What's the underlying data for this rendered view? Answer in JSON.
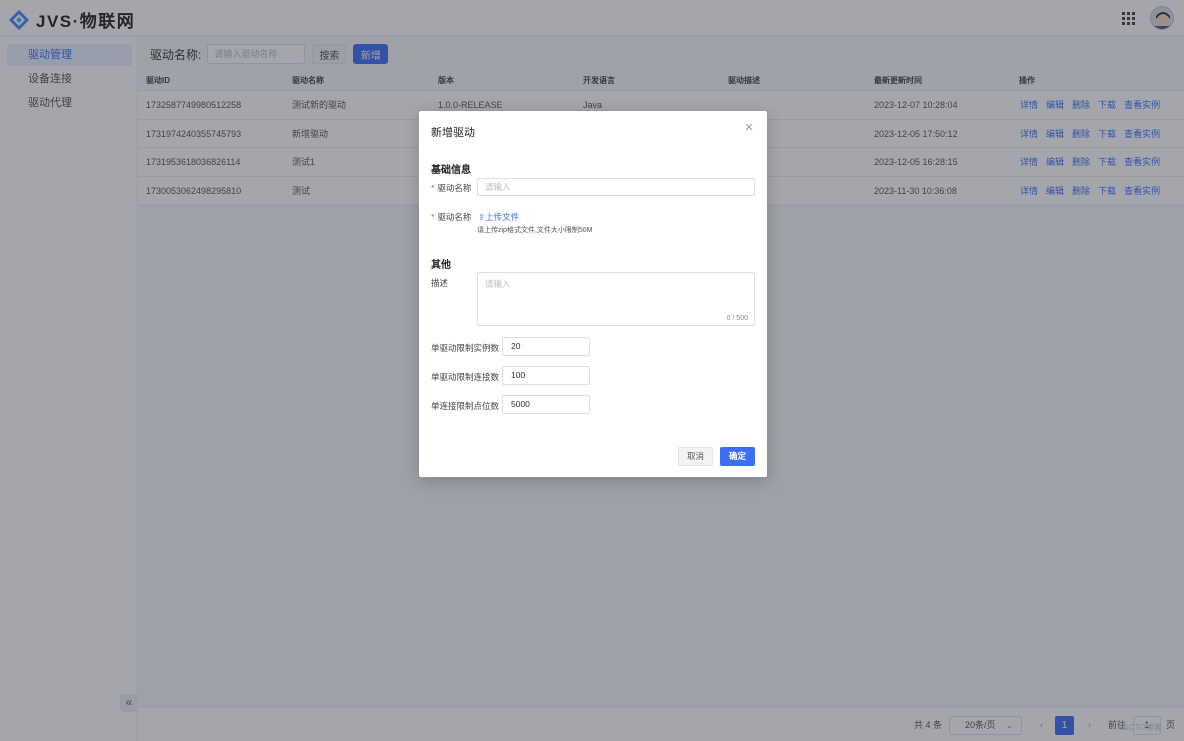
{
  "header": {
    "logo_text": "JVS·物联网"
  },
  "sidebar": {
    "items": [
      {
        "label": "驱动管理",
        "active": true
      },
      {
        "label": "设备连接",
        "active": false
      },
      {
        "label": "驱动代理",
        "active": false
      }
    ],
    "collapse_label": "«"
  },
  "toolbar": {
    "filter_label": "驱动名称:",
    "filter_placeholder": "请输入驱动名称",
    "search_label": "搜索",
    "add_label": "新增"
  },
  "table": {
    "columns": [
      "驱动ID",
      "驱动名称",
      "版本",
      "开发语言",
      "驱动描述",
      "最新更新时间",
      "操作"
    ],
    "rows": [
      {
        "id": "1732587749980512258",
        "name": "测试新的驱动",
        "version": "1.0.0-RELEASE",
        "lang": "Java",
        "desc": "",
        "updated": "2023-12-07 10:28:04"
      },
      {
        "id": "1731974240355745793",
        "name": "新增驱动",
        "version": "",
        "lang": "",
        "desc": "",
        "updated": "2023-12-05 17:50:12"
      },
      {
        "id": "1731953618036826114",
        "name": "测试1",
        "version": "",
        "lang": "",
        "desc": "",
        "updated": "2023-12-05 16:28:15"
      },
      {
        "id": "1730053062498295810",
        "name": "测试",
        "version": "",
        "lang": "",
        "desc": "",
        "updated": "2023-11-30 10:36:08"
      }
    ],
    "actions": [
      "详情",
      "编辑",
      "删除",
      "下载",
      "查看实例"
    ]
  },
  "pagination": {
    "total": "共 4 条",
    "page_size": "20条/页",
    "current_page": "1",
    "jump_prefix": "前往",
    "jump_value": "1",
    "jump_suffix": "页"
  },
  "watermark": "51CTO博客",
  "modal": {
    "title": "新增驱动",
    "section_basic": "基础信息",
    "name_label": "驱动名称",
    "name_placeholder": "请输入",
    "file_label": "驱动名称",
    "upload_label": "上传文件",
    "upload_hint": "请上传zip格式文件,文件大小限制50M",
    "section_other": "其他",
    "desc_label": "描述",
    "desc_placeholder": "请输入",
    "desc_counter": "0 / 500",
    "max_instances_label": "单驱动限制实例数",
    "max_instances_value": "20",
    "max_connections_label": "单驱动限制连接数",
    "max_connections_value": "100",
    "max_points_label": "单连接限制点位数",
    "max_points_value": "5000",
    "cancel_label": "取消",
    "confirm_label": "确定"
  },
  "colors": {
    "primary": "#3b6ef5",
    "required": "#e55353"
  }
}
